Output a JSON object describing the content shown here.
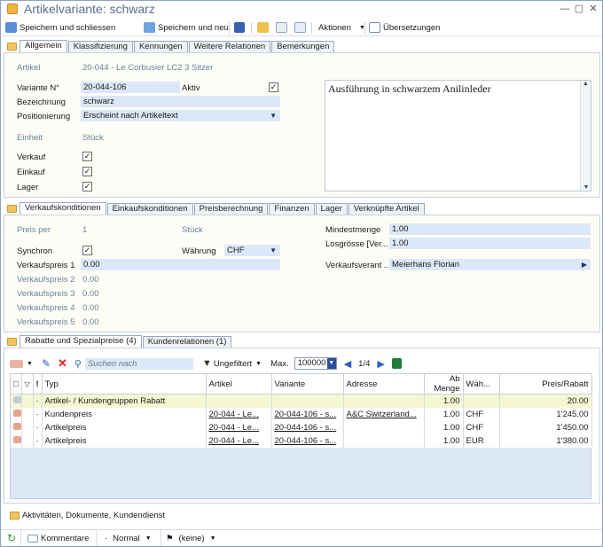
{
  "window": {
    "title": "Artikelvariante: schwarz"
  },
  "toolbar": {
    "save_close": "Speichern und schliessen",
    "save_new": "Speichern und neu",
    "actions": "Aktionen",
    "translations": "Übersetzungen"
  },
  "tabs1": [
    "Allgemein",
    "Klassifizierung",
    "Kennungen",
    "Weitere Relationen",
    "Bemerkungen"
  ],
  "general": {
    "artikel_label": "Artikel",
    "artikel_value": "20-044 - Le Corbusier LC2 3 Sitzer",
    "variante_label": "Variante N°",
    "variante_value": "20-044-106",
    "aktiv_label": "Aktiv",
    "bezeichnung_label": "Bezeichnung",
    "bezeichnung_value": "schwarz",
    "positionierung_label": "Positionierung",
    "positionierung_value": "Erscheint nach Artikeltext",
    "einheit_label": "Einheit",
    "einheit_value": "Stück",
    "verkauf_label": "Verkauf",
    "einkauf_label": "Einkauf",
    "lager_label": "Lager",
    "description": "Ausführung in schwarzem Anilinleder"
  },
  "tabs2": [
    "Verkaufskonditionen",
    "Einkaufskonditionen",
    "Preisberechnung",
    "Finanzen",
    "Lager",
    "Verknüpfte Artikel"
  ],
  "sales": {
    "preis_per_label": "Preis per",
    "preis_per_value": "1",
    "preis_per_unit": "Stück",
    "synchron_label": "Synchron",
    "waehrung_label": "Währung",
    "waehrung_value": "CHF",
    "vp1_label": "Verkaufspreis 1",
    "vp1_value": "0.00",
    "vp2_label": "Verkaufspreis 2",
    "vp2_value": "0.00",
    "vp3_label": "Verkaufspreis 3",
    "vp3_value": "0.00",
    "vp4_label": "Verkaufspreis 4",
    "vp4_value": "0.00",
    "vp5_label": "Verkaufspreis 5",
    "vp5_value": "0.00",
    "mindestmenge_label": "Mindestmenge",
    "mindestmenge_value": "1.00",
    "losgroesse_label": "Losgrösse [Ver...",
    "losgroesse_value": "1.00",
    "verantwortlich_label": "Verkaufsverant ...",
    "verantwortlich_value": "Meierhans Florian"
  },
  "tabs3": [
    "Rabatte und Spezialpreise (4)",
    "Kundenrelationen (1)"
  ],
  "grid": {
    "search_placeholder": "Suchen nach",
    "filter": "Ungefiltert",
    "max_label": "Max.",
    "max_value": "100000",
    "page": "1/4",
    "headers": [
      "Typ",
      "Artikel",
      "Variante",
      "Adresse",
      "Ab Menge",
      "Wäh...",
      "Preis/Rabatt"
    ],
    "rows": [
      {
        "typ": "Artikel- / Kundengruppen Rabatt",
        "artikel": "",
        "variante": "",
        "adresse": "",
        "menge": "1.00",
        "waehrung": "",
        "preis": "20.00"
      },
      {
        "typ": "Kundenpreis",
        "artikel": "20-044 - Le...",
        "variante": "20-044-106 - s...",
        "adresse": "A&C Switzerland...",
        "menge": "1.00",
        "waehrung": "CHF",
        "preis": "1'245.00"
      },
      {
        "typ": "Artikelpreis",
        "artikel": "20-044 - Le...",
        "variante": "20-044-106 - s...",
        "adresse": "",
        "menge": "1.00",
        "waehrung": "CHF",
        "preis": "1'450.00"
      },
      {
        "typ": "Artikelpreis",
        "artikel": "20-044 - Le...",
        "variante": "20-044-106 - s...",
        "adresse": "",
        "menge": "1.00",
        "waehrung": "EUR",
        "preis": "1'380.00"
      }
    ]
  },
  "activities": "Aktivitäten, Dokumente, Kundendienst",
  "status": {
    "comments": "Kommentare",
    "priority": "Normal",
    "flag": "(keine)"
  }
}
